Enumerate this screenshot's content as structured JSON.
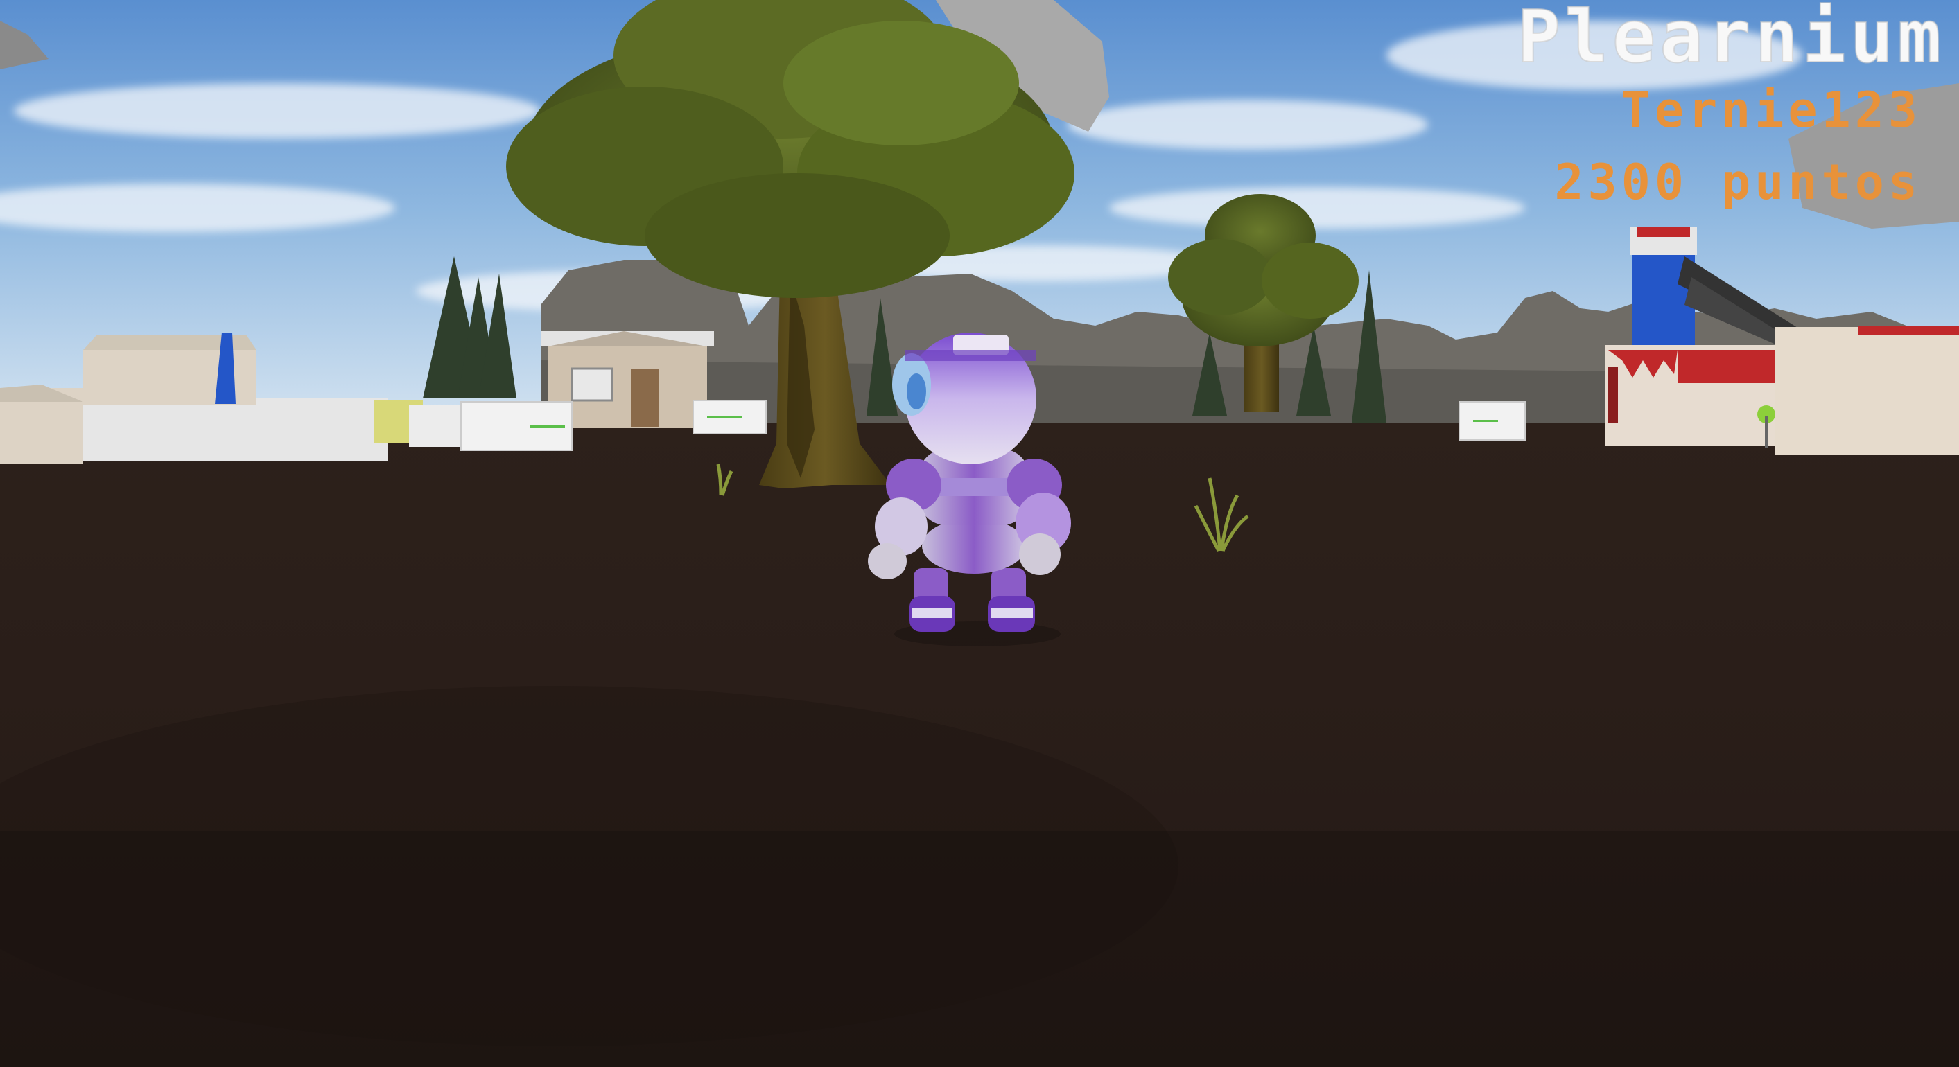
{
  "hud": {
    "game_title": "Plearnium",
    "player_name": "Ternie123",
    "score_text": "2300 puntos"
  },
  "colors": {
    "hud_title": "#f8f8f8",
    "hud_player": "#e8923a",
    "hud_score": "#e8923a",
    "ground": "#2a1e19",
    "sky_top": "#5a8fd0",
    "sky_bottom": "#d7e6f2",
    "robot_primary": "#8b5cc7",
    "robot_secondary": "#d8d0e8"
  },
  "scene": {
    "player_character": "robot-avatar",
    "objects": [
      "oak-tree",
      "small-oak-tree",
      "pine-trees",
      "house",
      "rocky-cliffs",
      "signboards",
      "red-white-building",
      "blue-tower",
      "floating-rocks",
      "grass-tuft"
    ]
  }
}
